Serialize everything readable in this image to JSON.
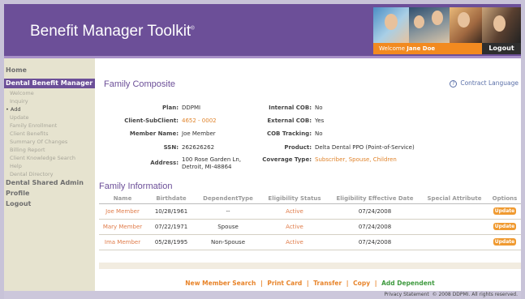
{
  "header": {
    "app_title": "Benefit Manager Toolkit",
    "trademark": "®",
    "welcome_label": "Welcome",
    "user_name": "Jane Doe",
    "logout_label": "Logout"
  },
  "sidebar": {
    "home": "Home",
    "dental_benefit_manager": "Dental Benefit Manager",
    "sub_items": [
      "Welcome",
      "Inquiry",
      "Add",
      "Update",
      "Family Enrollment",
      "Client Benefits",
      "Summary Of Changes",
      "Billing Report",
      "Client Knowledge Search",
      "Help",
      "Dental Directory"
    ],
    "current_marker": "•",
    "dental_shared_admin": "Dental Shared Admin",
    "profile": "Profile",
    "logout": "Logout"
  },
  "composite": {
    "title": "Family Composite",
    "contract_link": "Contract Language",
    "plan_label": "Plan:",
    "plan_value": "DDPMI",
    "client_label": "Client-SubClient:",
    "client_value": "4652 - 0002",
    "member_label": "Member Name:",
    "member_value": "Joe Member",
    "ssn_label": "SSN:",
    "ssn_value": "262626262",
    "address_label": "Address:",
    "address_line1": "100 Rose Garden Ln,",
    "address_line2": "Detroit, MI-48864",
    "internal_cob_label": "Internal COB:",
    "internal_cob_value": "No",
    "external_cob_label": "External COB:",
    "external_cob_value": "Yes",
    "cob_tracking_label": "COB Tracking:",
    "cob_tracking_value": "No",
    "product_label": "Product:",
    "product_value": "Delta Dental PPO (Point-of-Service)",
    "coverage_label": "Coverage Type:",
    "coverage_value": "Subscriber, Spouse, Children"
  },
  "family": {
    "title": "Family Information",
    "columns": [
      "Name",
      "Birthdate",
      "DependentType",
      "Eligibility Status",
      "Eligibility Effective Date",
      "Special Attribute",
      "Options"
    ],
    "rows": [
      {
        "name": "Joe Member",
        "birthdate": "10/28/1961",
        "dependent_type": "--",
        "status": "Active",
        "effective": "07/24/2008",
        "special": "",
        "option": "Update"
      },
      {
        "name": "Mary Member",
        "birthdate": "07/22/1971",
        "dependent_type": "Spouse",
        "status": "Active",
        "effective": "07/24/2008",
        "special": "",
        "option": "Update"
      },
      {
        "name": "Ima Member",
        "birthdate": "05/28/1995",
        "dependent_type": "Non-Spouse",
        "status": "Active",
        "effective": "07/24/2008",
        "special": "",
        "option": "Update"
      }
    ]
  },
  "actions": {
    "new_member_search": "New Member Search",
    "print_card": "Print Card",
    "transfer": "Transfer",
    "copy": "Copy",
    "add_dependent": "Add Dependent",
    "separator": "|"
  },
  "footer": {
    "privacy": "Privacy Statement",
    "copyright": "© 2008 DDPMI. All rights reserved."
  },
  "colors": {
    "brand_purple": "#6c4f98",
    "accent_orange": "#f09a30",
    "link_green": "#3f9a3f"
  }
}
